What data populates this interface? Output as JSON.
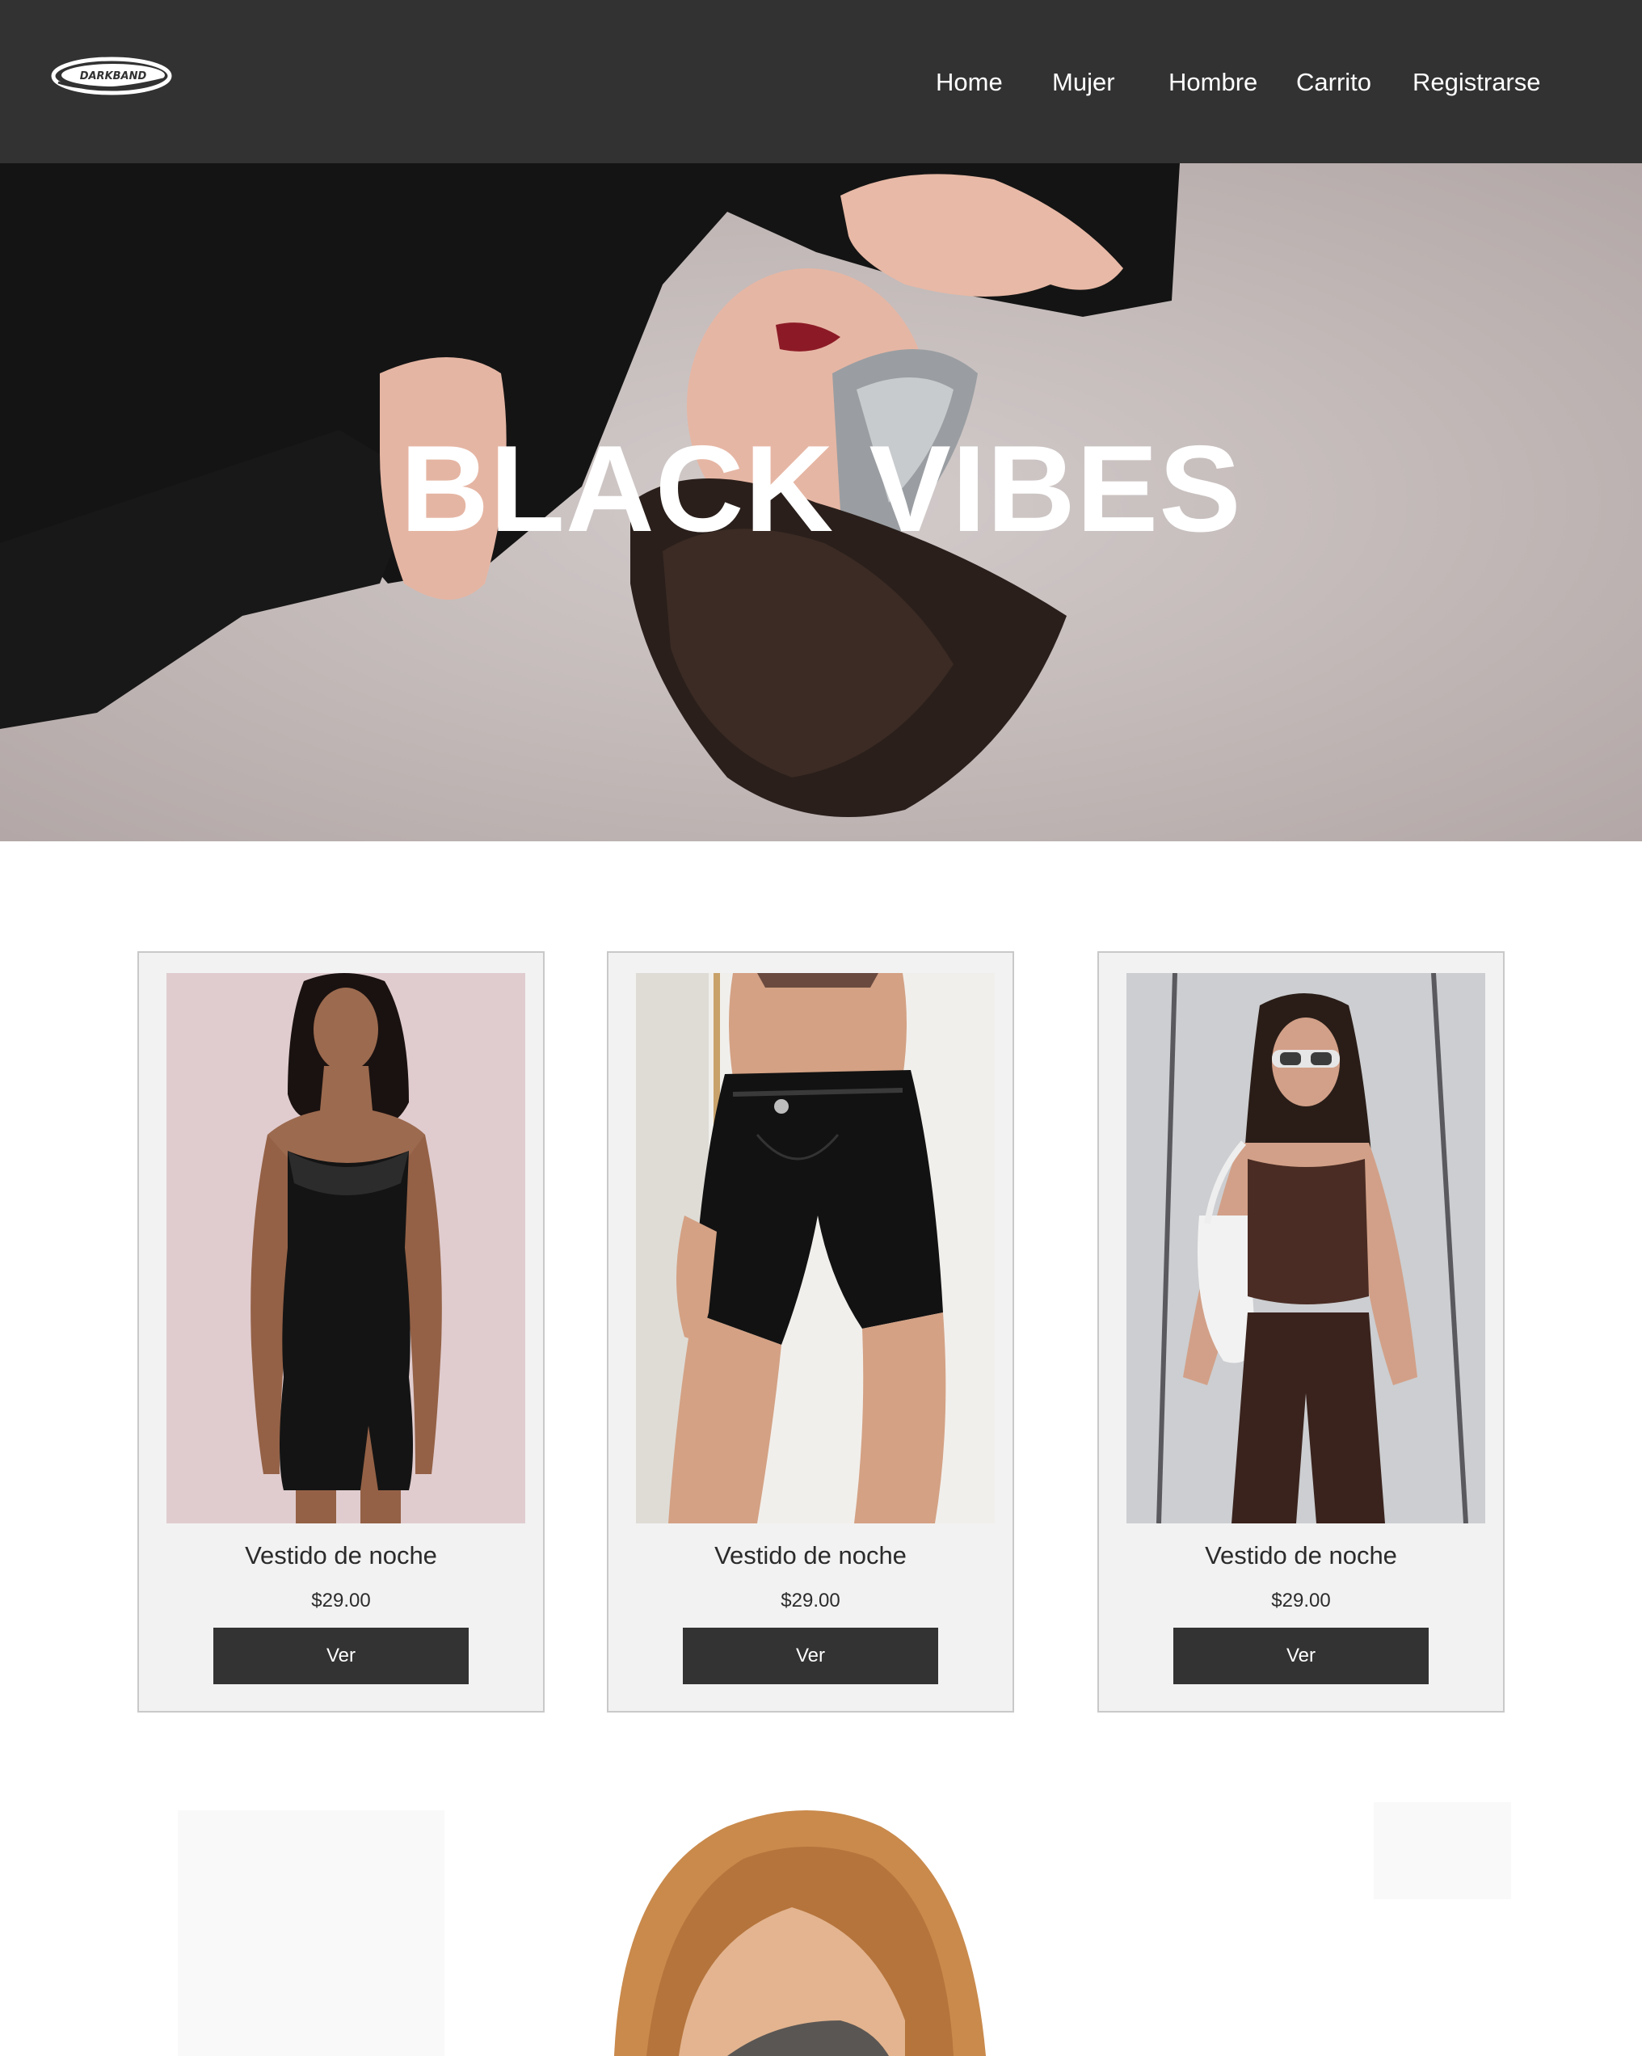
{
  "brand": {
    "logo_text": "DARKBAND",
    "logo_icon": "brand-logo-oval"
  },
  "nav": {
    "items": [
      {
        "label": "Home"
      },
      {
        "label": "Mujer"
      },
      {
        "label": "Hombre"
      },
      {
        "label": "Carrito"
      },
      {
        "label": "Registrarse"
      }
    ]
  },
  "hero": {
    "title": "BLACK VIBES"
  },
  "products": [
    {
      "name": "Vestido de noche",
      "price": "$29.00",
      "button": "Ver"
    },
    {
      "name": "Vestido de noche",
      "price": "$29.00",
      "button": "Ver"
    },
    {
      "name": "Vestido de noche",
      "price": "$29.00",
      "button": "Ver"
    }
  ],
  "colors": {
    "header_bg": "#323232",
    "card_bg": "#f2f2f2",
    "card_border": "#c9c9c9",
    "button_bg": "#333333",
    "text_dark": "#2b2b2b",
    "text_light": "#ffffff"
  }
}
